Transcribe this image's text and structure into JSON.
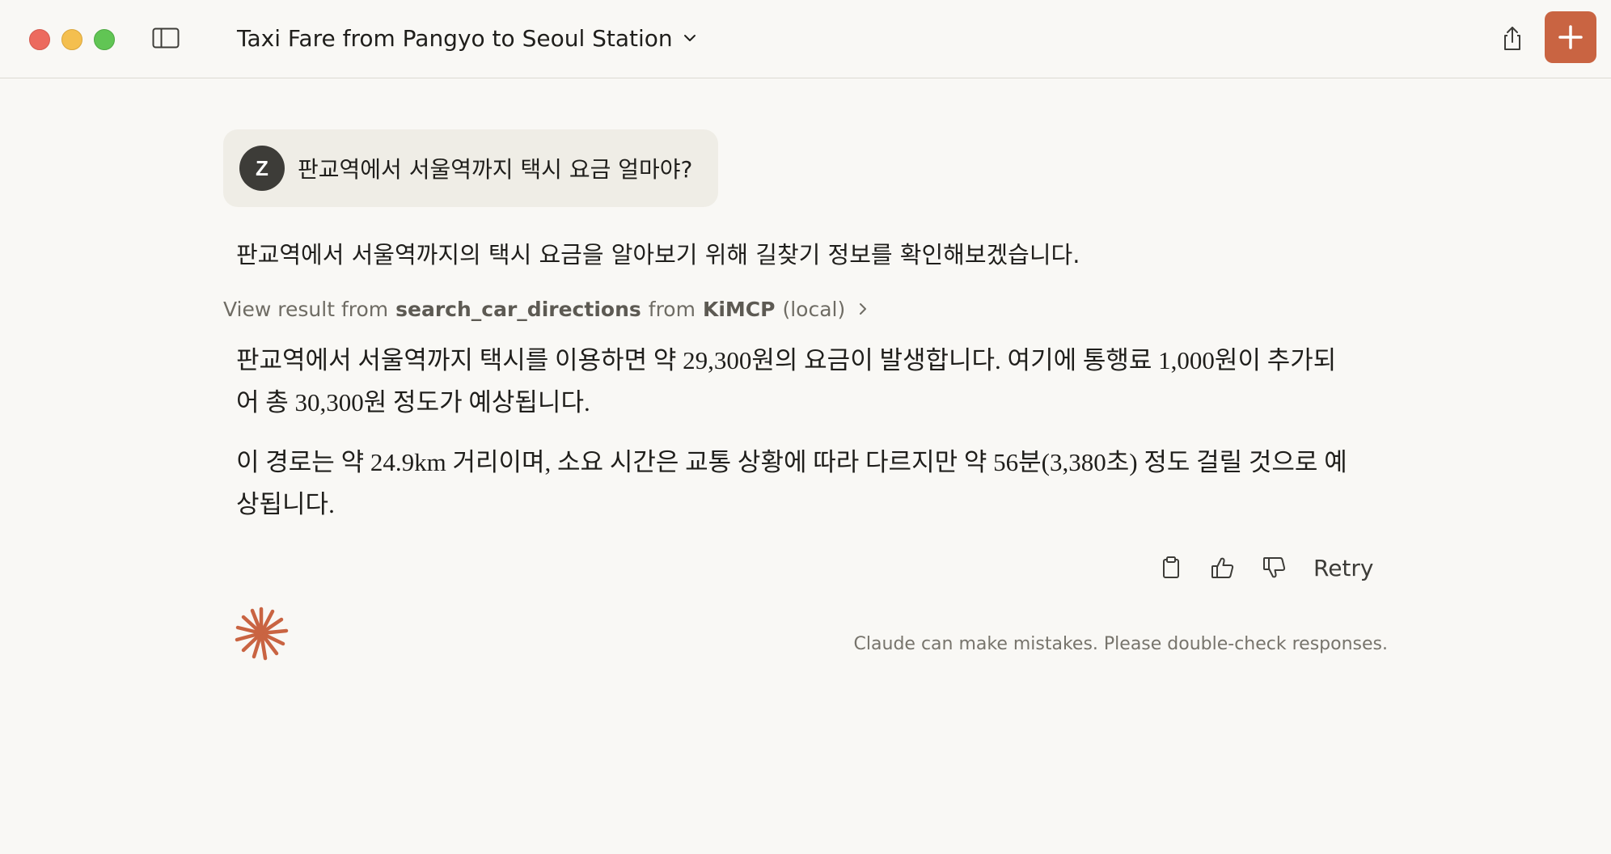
{
  "window": {
    "traffic_lights": [
      "close",
      "minimize",
      "zoom"
    ]
  },
  "header": {
    "title": "Taxi Fare from Pangyo to Seoul Station",
    "title_dropdown_icon": "chevron-down-icon",
    "sidebar_toggle_icon": "sidebar-icon",
    "share_icon": "share-icon",
    "new_chat_icon": "plus-icon"
  },
  "conversation": {
    "user_message": {
      "avatar_initial": "Z",
      "text": "판교역에서 서울역까지 택시 요금 얼마야?"
    },
    "assistant": {
      "intro": "판교역에서 서울역까지의 택시 요금을 알아보기 위해 길찾기 정보를 확인해보겠습니다.",
      "tool_result": {
        "prefix": "View result from",
        "tool_name": "search_car_directions",
        "middle": "from",
        "server_name": "KiMCP",
        "suffix": "(local)"
      },
      "paragraphs": [
        "판교역에서 서울역까지 택시를 이용하면 약 29,300원의 요금이 발생합니다. 여기에 통행료 1,000원이 추가되어 총 30,300원 정도가 예상됩니다.",
        "이 경로는 약 24.9km 거리이며, 소요 시간은 교통 상황에 따라 다르지만 약 56분(3,380초) 정도 걸릴 것으로 예상됩니다."
      ]
    },
    "actions": {
      "copy_icon": "clipboard-icon",
      "thumbs_up_icon": "thumbs-up-icon",
      "thumbs_down_icon": "thumbs-down-icon",
      "retry_label": "Retry"
    }
  },
  "footer": {
    "disclaimer": "Claude can make mistakes. Please double-check responses."
  },
  "colors": {
    "background": "#f9f8f5",
    "accent": "#c96442",
    "user_bubble": "#efede6",
    "avatar": "#3d3c38",
    "muted_text": "#6f6c64"
  }
}
